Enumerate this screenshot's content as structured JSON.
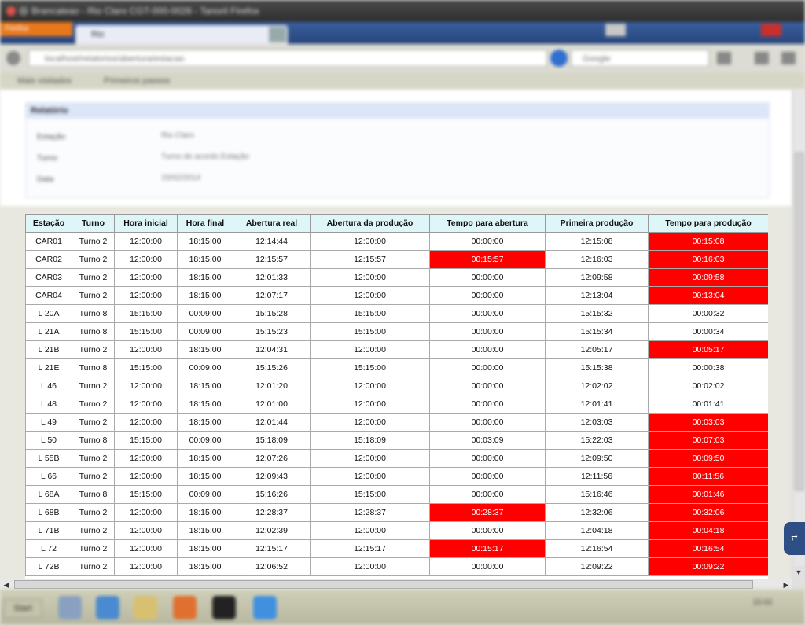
{
  "browser": {
    "window_title": "Brancaleao - Rio Claro CGT-000-0026 - Tanoril Firefox",
    "firefox_menu": "Firefox",
    "tab_title": "Rio",
    "url": "localhost/relatorios/abertura/estacao",
    "search_placeholder": "Google",
    "bookmarks": [
      "Mais visitados",
      "Primeiros passos"
    ]
  },
  "report": {
    "panel_title": "Relatório",
    "fields": [
      {
        "label": "Estação",
        "value": "Rio Claro"
      },
      {
        "label": "Turno",
        "value": "Turno de acordo Estação"
      },
      {
        "label": "Data",
        "value": "15/02/2014"
      }
    ]
  },
  "table": {
    "headers": [
      "Estação",
      "Turno",
      "Hora inicial",
      "Hora final",
      "Abertura real",
      "Abertura da produção",
      "Tempo para abertura",
      "Primeira produção",
      "Tempo para produção"
    ],
    "highlight_color": "#ff0000",
    "rows": [
      {
        "estacao": "CAR01",
        "turno": "Turno 2",
        "hora_inicial": "12:00:00",
        "hora_final": "18:15:00",
        "abertura_real": "12:14:44",
        "abertura_producao": "12:00:00",
        "tempo_abertura": "00:00:00",
        "primeira_producao": "12:15:08",
        "tempo_producao": "00:15:08",
        "tempo_abertura_alert": false,
        "tempo_producao_alert": true
      },
      {
        "estacao": "CAR02",
        "turno": "Turno 2",
        "hora_inicial": "12:00:00",
        "hora_final": "18:15:00",
        "abertura_real": "12:15:57",
        "abertura_producao": "12:15:57",
        "tempo_abertura": "00:15:57",
        "primeira_producao": "12:16:03",
        "tempo_producao": "00:16:03",
        "tempo_abertura_alert": true,
        "tempo_producao_alert": true
      },
      {
        "estacao": "CAR03",
        "turno": "Turno 2",
        "hora_inicial": "12:00:00",
        "hora_final": "18:15:00",
        "abertura_real": "12:01:33",
        "abertura_producao": "12:00:00",
        "tempo_abertura": "00:00:00",
        "primeira_producao": "12:09:58",
        "tempo_producao": "00:09:58",
        "tempo_abertura_alert": false,
        "tempo_producao_alert": true
      },
      {
        "estacao": "CAR04",
        "turno": "Turno 2",
        "hora_inicial": "12:00:00",
        "hora_final": "18:15:00",
        "abertura_real": "12:07:17",
        "abertura_producao": "12:00:00",
        "tempo_abertura": "00:00:00",
        "primeira_producao": "12:13:04",
        "tempo_producao": "00:13:04",
        "tempo_abertura_alert": false,
        "tempo_producao_alert": true
      },
      {
        "estacao": "L 20A",
        "turno": "Turno 8",
        "hora_inicial": "15:15:00",
        "hora_final": "00:09:00",
        "abertura_real": "15:15:28",
        "abertura_producao": "15:15:00",
        "tempo_abertura": "00:00:00",
        "primeira_producao": "15:15:32",
        "tempo_producao": "00:00:32",
        "tempo_abertura_alert": false,
        "tempo_producao_alert": false
      },
      {
        "estacao": "L 21A",
        "turno": "Turno 8",
        "hora_inicial": "15:15:00",
        "hora_final": "00:09:00",
        "abertura_real": "15:15:23",
        "abertura_producao": "15:15:00",
        "tempo_abertura": "00:00:00",
        "primeira_producao": "15:15:34",
        "tempo_producao": "00:00:34",
        "tempo_abertura_alert": false,
        "tempo_producao_alert": false
      },
      {
        "estacao": "L 21B",
        "turno": "Turno 2",
        "hora_inicial": "12:00:00",
        "hora_final": "18:15:00",
        "abertura_real": "12:04:31",
        "abertura_producao": "12:00:00",
        "tempo_abertura": "00:00:00",
        "primeira_producao": "12:05:17",
        "tempo_producao": "00:05:17",
        "tempo_abertura_alert": false,
        "tempo_producao_alert": true
      },
      {
        "estacao": "L 21E",
        "turno": "Turno 8",
        "hora_inicial": "15:15:00",
        "hora_final": "00:09:00",
        "abertura_real": "15:15:26",
        "abertura_producao": "15:15:00",
        "tempo_abertura": "00:00:00",
        "primeira_producao": "15:15:38",
        "tempo_producao": "00:00:38",
        "tempo_abertura_alert": false,
        "tempo_producao_alert": false
      },
      {
        "estacao": "L 46",
        "turno": "Turno 2",
        "hora_inicial": "12:00:00",
        "hora_final": "18:15:00",
        "abertura_real": "12:01:20",
        "abertura_producao": "12:00:00",
        "tempo_abertura": "00:00:00",
        "primeira_producao": "12:02:02",
        "tempo_producao": "00:02:02",
        "tempo_abertura_alert": false,
        "tempo_producao_alert": false
      },
      {
        "estacao": "L 48",
        "turno": "Turno 2",
        "hora_inicial": "12:00:00",
        "hora_final": "18:15:00",
        "abertura_real": "12:01:00",
        "abertura_producao": "12:00:00",
        "tempo_abertura": "00:00:00",
        "primeira_producao": "12:01:41",
        "tempo_producao": "00:01:41",
        "tempo_abertura_alert": false,
        "tempo_producao_alert": false
      },
      {
        "estacao": "L 49",
        "turno": "Turno 2",
        "hora_inicial": "12:00:00",
        "hora_final": "18:15:00",
        "abertura_real": "12:01:44",
        "abertura_producao": "12:00:00",
        "tempo_abertura": "00:00:00",
        "primeira_producao": "12:03:03",
        "tempo_producao": "00:03:03",
        "tempo_abertura_alert": false,
        "tempo_producao_alert": true
      },
      {
        "estacao": "L 50",
        "turno": "Turno 8",
        "hora_inicial": "15:15:00",
        "hora_final": "00:09:00",
        "abertura_real": "15:18:09",
        "abertura_producao": "15:18:09",
        "tempo_abertura": "00:03:09",
        "primeira_producao": "15:22:03",
        "tempo_producao": "00:07:03",
        "tempo_abertura_alert": false,
        "tempo_producao_alert": true
      },
      {
        "estacao": "L 55B",
        "turno": "Turno 2",
        "hora_inicial": "12:00:00",
        "hora_final": "18:15:00",
        "abertura_real": "12:07:26",
        "abertura_producao": "12:00:00",
        "tempo_abertura": "00:00:00",
        "primeira_producao": "12:09:50",
        "tempo_producao": "00:09:50",
        "tempo_abertura_alert": false,
        "tempo_producao_alert": true
      },
      {
        "estacao": "L 66",
        "turno": "Turno 2",
        "hora_inicial": "12:00:00",
        "hora_final": "18:15:00",
        "abertura_real": "12:09:43",
        "abertura_producao": "12:00:00",
        "tempo_abertura": "00:00:00",
        "primeira_producao": "12:11:56",
        "tempo_producao": "00:11:56",
        "tempo_abertura_alert": false,
        "tempo_producao_alert": true
      },
      {
        "estacao": "L 68A",
        "turno": "Turno 8",
        "hora_inicial": "15:15:00",
        "hora_final": "00:09:00",
        "abertura_real": "15:16:26",
        "abertura_producao": "15:15:00",
        "tempo_abertura": "00:00:00",
        "primeira_producao": "15:16:46",
        "tempo_producao": "00:01:46",
        "tempo_abertura_alert": false,
        "tempo_producao_alert": true
      },
      {
        "estacao": "L 68B",
        "turno": "Turno 2",
        "hora_inicial": "12:00:00",
        "hora_final": "18:15:00",
        "abertura_real": "12:28:37",
        "abertura_producao": "12:28:37",
        "tempo_abertura": "00:28:37",
        "primeira_producao": "12:32:06",
        "tempo_producao": "00:32:06",
        "tempo_abertura_alert": true,
        "tempo_producao_alert": true
      },
      {
        "estacao": "L 71B",
        "turno": "Turno 2",
        "hora_inicial": "12:00:00",
        "hora_final": "18:15:00",
        "abertura_real": "12:02:39",
        "abertura_producao": "12:00:00",
        "tempo_abertura": "00:00:00",
        "primeira_producao": "12:04:18",
        "tempo_producao": "00:04:18",
        "tempo_abertura_alert": false,
        "tempo_producao_alert": true
      },
      {
        "estacao": "L 72",
        "turno": "Turno 2",
        "hora_inicial": "12:00:00",
        "hora_final": "18:15:00",
        "abertura_real": "12:15:17",
        "abertura_producao": "12:15:17",
        "tempo_abertura": "00:15:17",
        "primeira_producao": "12:16:54",
        "tempo_producao": "00:16:54",
        "tempo_abertura_alert": true,
        "tempo_producao_alert": true
      },
      {
        "estacao": "L 72B",
        "turno": "Turno 2",
        "hora_inicial": "12:00:00",
        "hora_final": "18:15:00",
        "abertura_real": "12:06:52",
        "abertura_producao": "12:00:00",
        "tempo_abertura": "00:00:00",
        "primeira_producao": "12:09:22",
        "tempo_producao": "00:09:22",
        "tempo_abertura_alert": false,
        "tempo_producao_alert": true
      }
    ]
  },
  "taskbar": {
    "start_label": "Start",
    "clock": "15:02"
  }
}
